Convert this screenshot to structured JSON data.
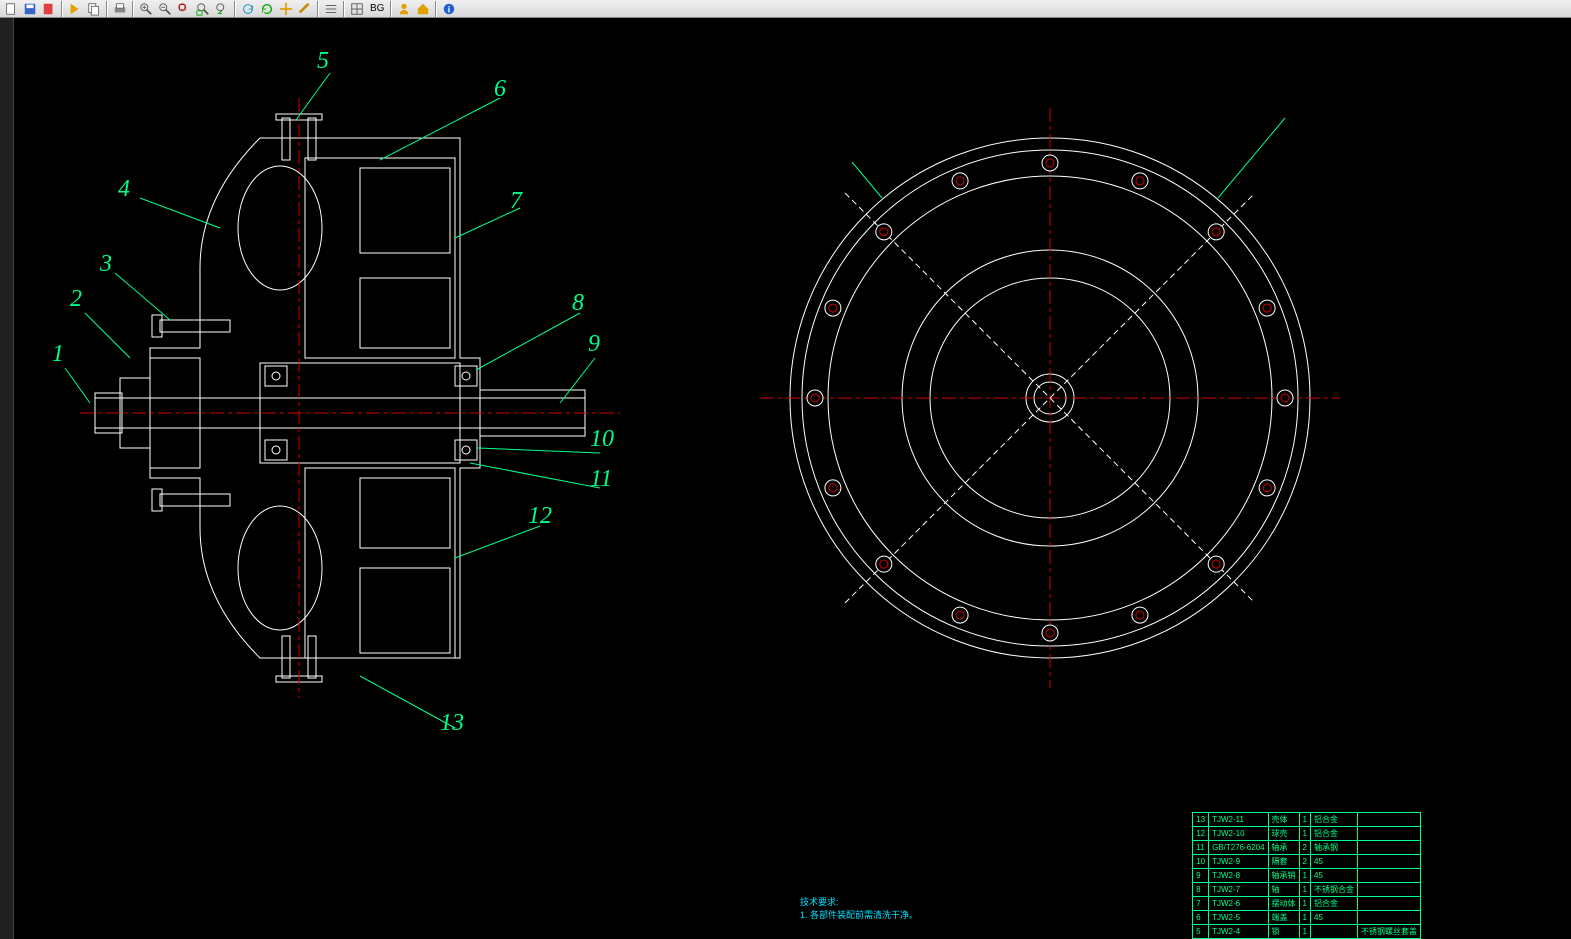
{
  "toolbar": {
    "bg_label": "BG"
  },
  "labels": {
    "l1": "1",
    "l2": "2",
    "l3": "3",
    "l4": "4",
    "l5": "5",
    "l6": "6",
    "l7": "7",
    "l8": "8",
    "l9": "9",
    "l10": "10",
    "l11": "11",
    "l12": "12",
    "l13": "13"
  },
  "parts_table": {
    "rows": [
      [
        "13",
        "TJW2-11",
        "壳体",
        "1",
        "铝合金",
        ""
      ],
      [
        "12",
        "TJW2-10",
        "球壳",
        "1",
        "铝合金",
        ""
      ],
      [
        "11",
        "GB/T276-6204",
        "轴承",
        "2",
        "轴承钢",
        ""
      ],
      [
        "10",
        "TJW2-9",
        "隔套",
        "2",
        "45",
        ""
      ],
      [
        "9",
        "TJW2-8",
        "轴承销",
        "1",
        "45",
        ""
      ],
      [
        "8",
        "TJW2-7",
        "轴",
        "1",
        "不锈钢合金",
        ""
      ],
      [
        "7",
        "TJW2-6",
        "摆动体",
        "1",
        "铝合金",
        ""
      ],
      [
        "6",
        "TJW2-5",
        "端盖",
        "1",
        "45",
        ""
      ],
      [
        "5",
        "TJW2-4",
        "锁",
        "1",
        "",
        "不锈钢螺丝套盖"
      ]
    ]
  },
  "notes": {
    "title": "技术要求:",
    "line1": "1. 各部件装配前需清洗干净。"
  }
}
